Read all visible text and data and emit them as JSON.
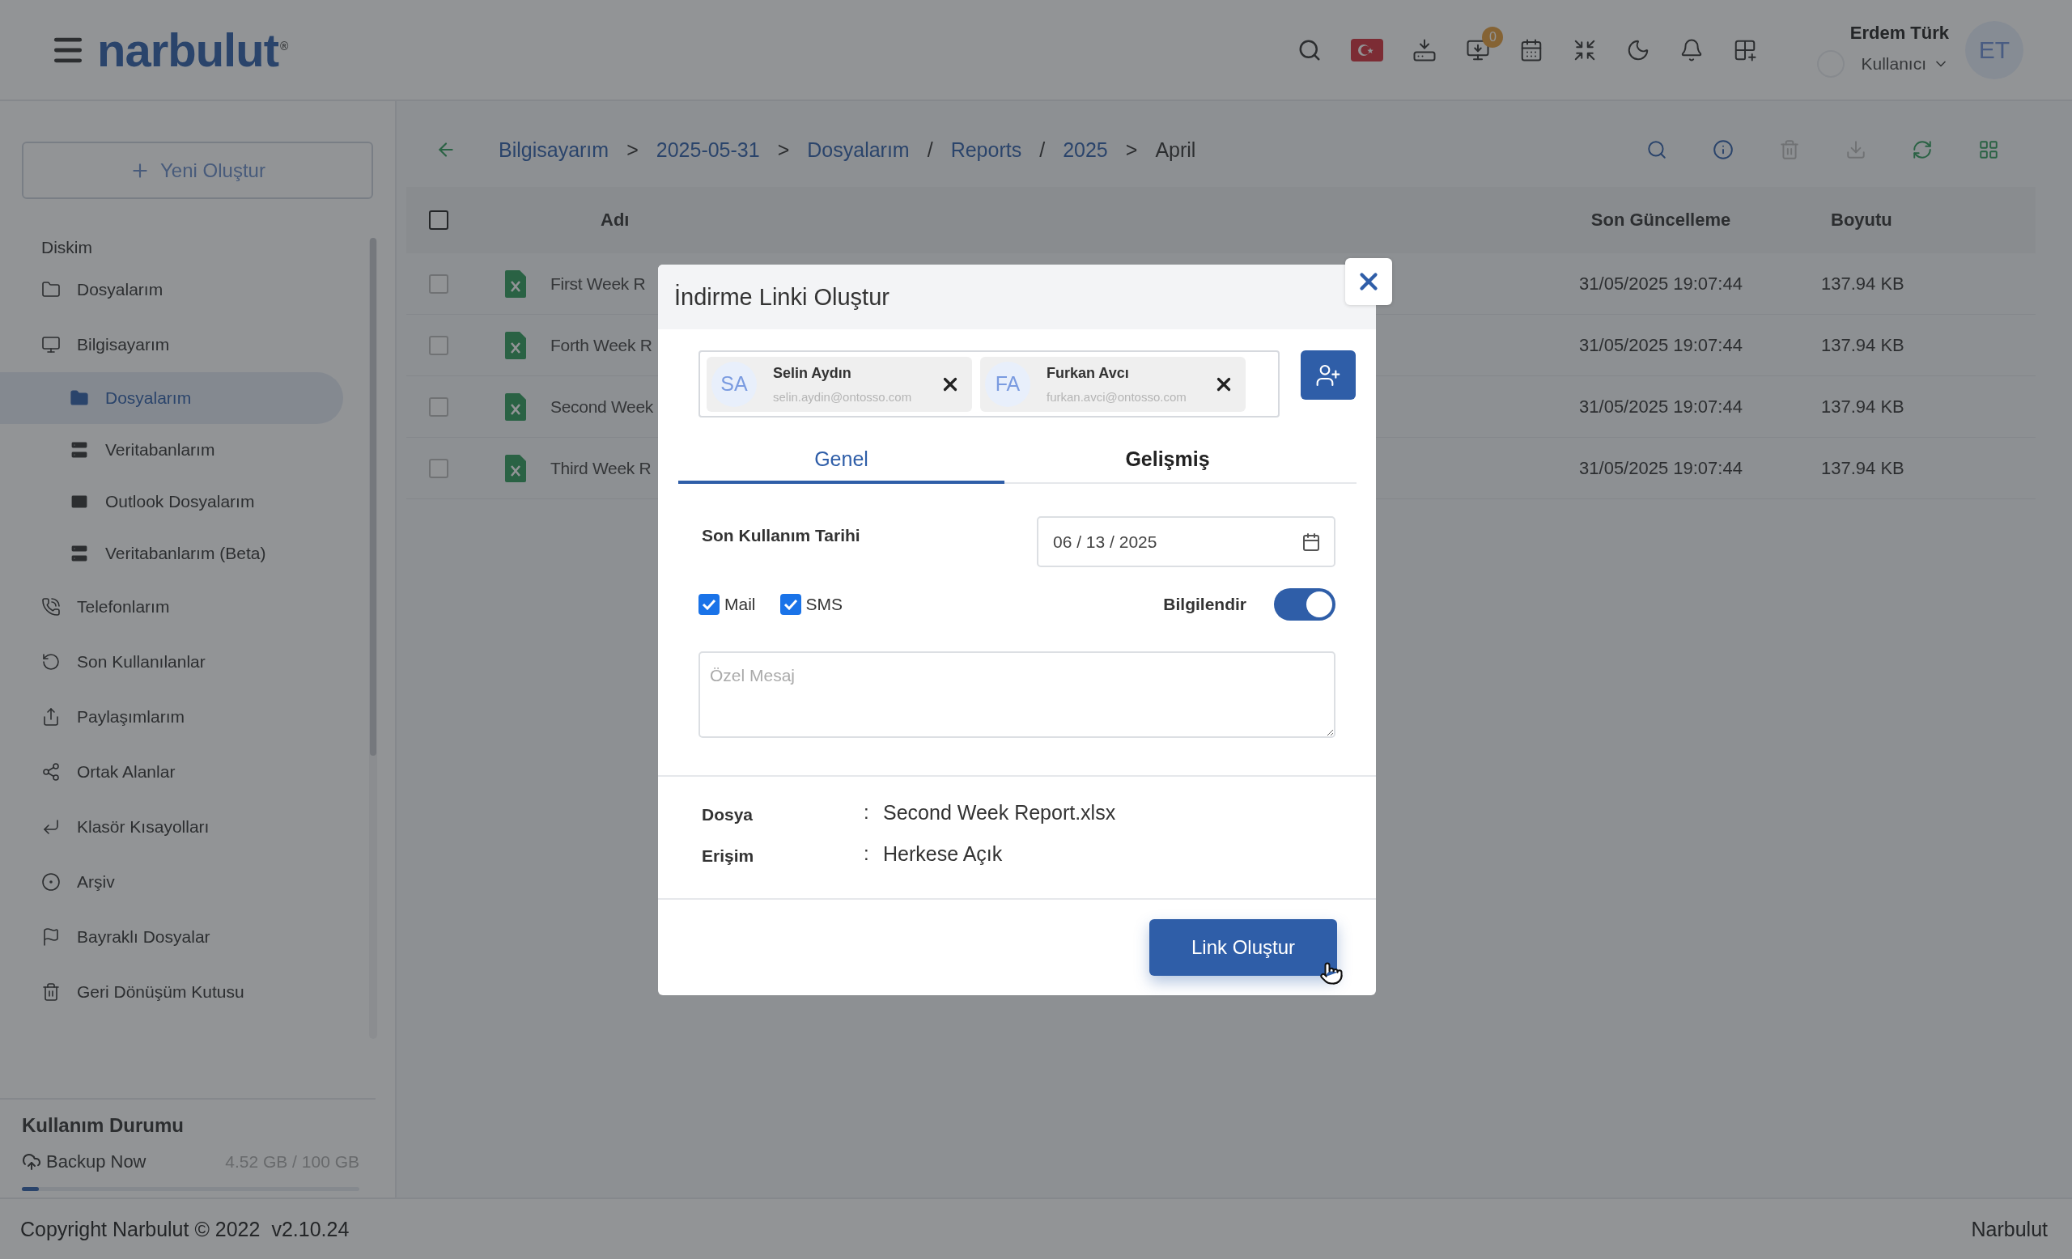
{
  "header": {
    "logo": "narbulut",
    "logo_mark": "®",
    "badge": "0",
    "user": {
      "name": "Erdem Türk",
      "role": "Kullanıcı",
      "initials": "ET"
    }
  },
  "sidebar": {
    "new_button": "Yeni Oluştur",
    "section": "Diskim",
    "items": [
      {
        "label": "Dosyalarım",
        "selected": false
      },
      {
        "label": "Bilgisayarım",
        "selected": false,
        "children": [
          {
            "label": "Dosyalarım",
            "selected": true
          },
          {
            "label": "Veritabanlarım",
            "selected": false
          },
          {
            "label": "Outlook Dosyalarım",
            "selected": false
          },
          {
            "label": "Veritabanlarım (Beta)",
            "selected": false
          }
        ]
      },
      {
        "label": "Telefonlarım",
        "selected": false
      },
      {
        "label": "Son Kullanılanlar",
        "selected": false
      },
      {
        "label": "Paylaşımlarım",
        "selected": false
      },
      {
        "label": "Ortak Alanlar",
        "selected": false
      },
      {
        "label": "Klasör Kısayolları",
        "selected": false
      },
      {
        "label": "Arşiv",
        "selected": false
      },
      {
        "label": "Bayraklı Dosyalar",
        "selected": false
      },
      {
        "label": "Geri Dönüşüm Kutusu",
        "selected": false
      }
    ],
    "usage": {
      "title": "Kullanım Durumu",
      "backup": "Backup Now",
      "amount": "4.52 GB / 100 GB",
      "level": 0.05
    }
  },
  "breadcrumb": [
    {
      "label": "Bilgisayarım",
      "selected": false
    },
    {
      "sep": ">",
      "label": "2025-05-31",
      "selected": false
    },
    {
      "sep": ">",
      "label": "Dosyalarım",
      "selected": false
    },
    {
      "sep": "/",
      "label": "Reports",
      "selected": false
    },
    {
      "sep": "/",
      "label": "2025",
      "selected": false
    },
    {
      "sep": ">",
      "label": "April",
      "selected": true
    }
  ],
  "table": {
    "checked": false,
    "columns": [
      "Adı",
      "Son Güncelleme",
      "Boyutu"
    ],
    "rows": [
      {
        "name": "First Week R",
        "updated": "31/05/2025 19:07:44",
        "size": "137.94 KB",
        "checked": false
      },
      {
        "name": "Forth Week R",
        "updated": "31/05/2025 19:07:44",
        "size": "137.94 KB",
        "checked": false
      },
      {
        "name": "Second Week",
        "updated": "31/05/2025 19:07:44",
        "size": "137.94 KB",
        "checked": false
      },
      {
        "name": "Third Week R",
        "updated": "31/05/2025 19:07:44",
        "size": "137.94 KB",
        "checked": false
      }
    ]
  },
  "dialog": {
    "title": "İndirme Linki Oluştur",
    "recipients": [
      {
        "initials": "SA",
        "name": "Selin Aydın",
        "email": "selin.aydin@ontosso.com"
      },
      {
        "initials": "FA",
        "name": "Furkan Avcı",
        "email": "furkan.avci@ontosso.com"
      }
    ],
    "tabs": [
      {
        "label": "Genel",
        "selected": true
      },
      {
        "label": "Gelişmiş",
        "selected": false
      }
    ],
    "expiry_label": "Son Kullanım Tarihi",
    "expiry_date": "06 / 13 / 2025",
    "channels": [
      {
        "label": "Mail",
        "checked": true
      },
      {
        "label": "SMS",
        "checked": true
      }
    ],
    "notify": {
      "label": "Bilgilendir",
      "on": true
    },
    "message": {
      "placeholder": "Özel Mesaj"
    },
    "info": [
      {
        "label": "Dosya",
        "sep": ":",
        "value": "Second Week Report.xlsx"
      },
      {
        "label": "Erişim",
        "sep": ":",
        "value": "Herkese Açık"
      }
    ],
    "submit": "Link Oluştur"
  },
  "footer": {
    "copyright": "Copyright Narbulut © 2022",
    "version": "v2.10.24",
    "brand": "Narbulut"
  }
}
